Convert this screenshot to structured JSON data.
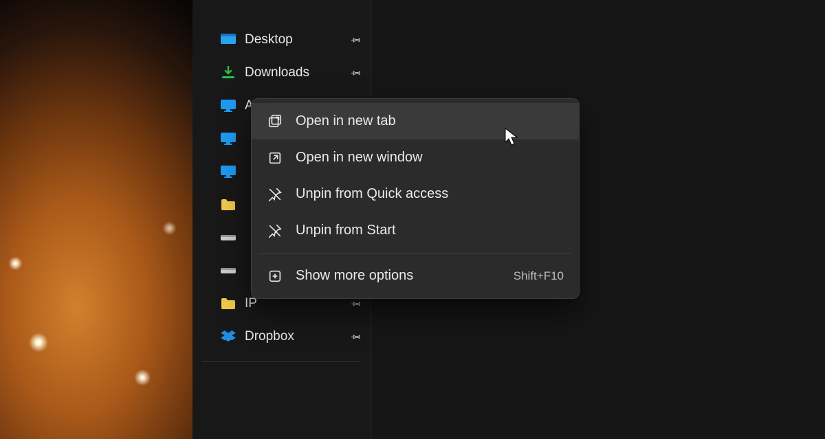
{
  "sidebar": {
    "items": [
      {
        "id": "desktop",
        "label": "Desktop",
        "icon": "desktop-icon",
        "pinned": true
      },
      {
        "id": "downloads",
        "label": "Downloads",
        "icon": "download-icon",
        "pinned": true
      },
      {
        "id": "arrakis",
        "label": "Arrakis",
        "icon": "monitor-icon",
        "pinned": true
      },
      {
        "id": "pc2",
        "label": "",
        "icon": "monitor-icon",
        "pinned": false
      },
      {
        "id": "pc3",
        "label": "",
        "icon": "monitor-icon",
        "pinned": false
      },
      {
        "id": "folder1",
        "label": "",
        "icon": "folder-icon",
        "pinned": false
      },
      {
        "id": "drive1",
        "label": "",
        "icon": "drive-icon",
        "pinned": false
      },
      {
        "id": "drive2",
        "label": "",
        "icon": "drive-icon",
        "pinned": false
      },
      {
        "id": "ip",
        "label": "IP",
        "icon": "folder-icon",
        "pinned": true
      },
      {
        "id": "dropbox",
        "label": "Dropbox",
        "icon": "dropbox-icon",
        "pinned": true
      }
    ]
  },
  "context_menu": {
    "items": [
      {
        "id": "new-tab",
        "label": "Open in new tab",
        "icon": "new-tab-icon",
        "hover": true
      },
      {
        "id": "new-window",
        "label": "Open in new window",
        "icon": "new-window-icon"
      },
      {
        "id": "unpin-quick",
        "label": "Unpin from Quick access",
        "icon": "unpin-icon"
      },
      {
        "id": "unpin-start",
        "label": "Unpin from Start",
        "icon": "unpin-icon"
      },
      {
        "sep": true
      },
      {
        "id": "show-more",
        "label": "Show more options",
        "icon": "more-options-icon",
        "shortcut": "Shift+F10"
      }
    ]
  }
}
